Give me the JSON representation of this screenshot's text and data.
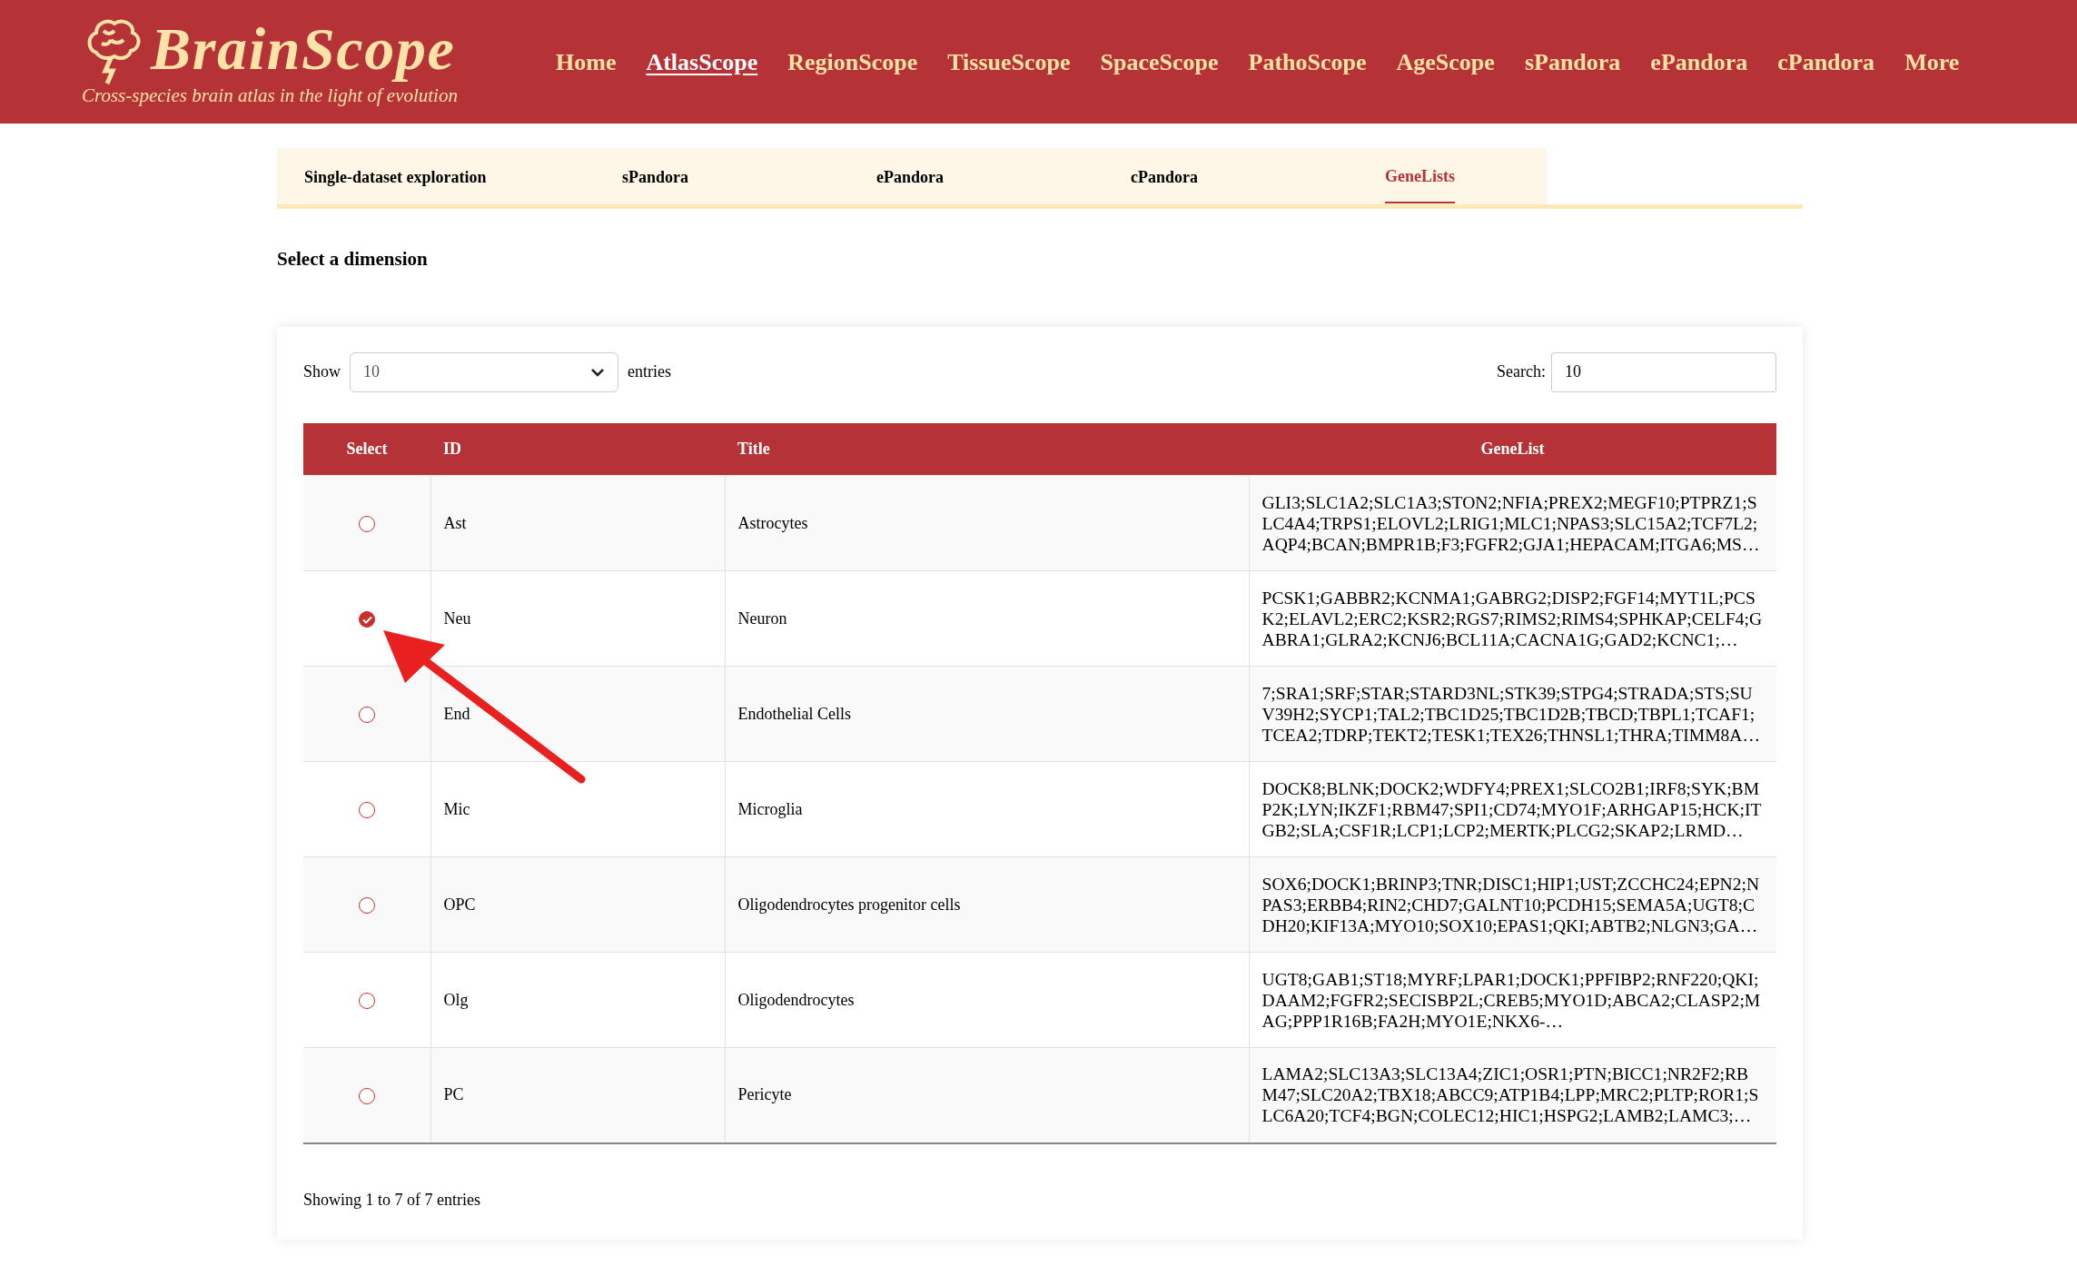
{
  "logo": {
    "title": "BrainScope",
    "tagline": "Cross-species brain atlas in the light of evolution"
  },
  "nav": [
    {
      "label": "Home",
      "selected": false
    },
    {
      "label": "AtlasScope",
      "selected": true
    },
    {
      "label": "RegionScope",
      "selected": false
    },
    {
      "label": "TissueScope",
      "selected": false
    },
    {
      "label": "SpaceScope",
      "selected": false
    },
    {
      "label": "PathoScope",
      "selected": false
    },
    {
      "label": "AgeScope",
      "selected": false
    },
    {
      "label": "sPandora",
      "selected": false
    },
    {
      "label": "ePandora",
      "selected": false
    },
    {
      "label": "cPandora",
      "selected": false
    },
    {
      "label": "More",
      "selected": false
    }
  ],
  "tabs": [
    {
      "label": "Single-dataset exploration",
      "selected": false
    },
    {
      "label": "sPandora",
      "selected": false
    },
    {
      "label": "ePandora",
      "selected": false
    },
    {
      "label": "cPandora",
      "selected": false
    },
    {
      "label": "GeneLists",
      "selected": true
    }
  ],
  "section_title": "Select a dimension",
  "table_controls": {
    "show_label": "Show",
    "page_size": "10",
    "entries_label": "entries",
    "search_label": "Search:",
    "search_value": "10"
  },
  "table": {
    "columns": [
      "Select",
      "ID",
      "Title",
      "GeneList"
    ],
    "rows": [
      {
        "selected": false,
        "id": "Ast",
        "title": "Astrocytes",
        "genelist": "GLI3;SLC1A2;SLC1A3;STON2;NFIA;PREX2;MEGF10;PTPRZ1;SLC4A4;TRPS1;ELOVL2;LRIG1;MLC1;NPAS3;SLC15A2;TCF7L2;AQP4;BCAN;BMPR1B;F3;FGFR2;GJA1;HEPACAM;ITGA6;MS…"
      },
      {
        "selected": true,
        "id": "Neu",
        "title": "Neuron",
        "genelist": "PCSK1;GABBR2;KCNMA1;GABRG2;DISP2;FGF14;MYT1L;PCSK2;ELAVL2;ERC2;KSR2;RGS7;RIMS2;RIMS4;SPHKAP;CELF4;GABRA1;GLRA2;KCNJ6;BCL11A;CACNA1G;GAD2;KCNC1;…"
      },
      {
        "selected": false,
        "id": "End",
        "title": "Endothelial Cells",
        "genelist": "7;SRA1;SRF;STAR;STARD3NL;STK39;STPG4;STRADA;STS;SUV39H2;SYCP1;TAL2;TBC1D25;TBC1D2B;TBCD;TBPL1;TCAF1;TCEA2;TDRP;TEKT2;TESK1;TEX26;THNSL1;THRA;TIMM8A…"
      },
      {
        "selected": false,
        "id": "Mic",
        "title": "Microglia",
        "genelist": "DOCK8;BLNK;DOCK2;WDFY4;PREX1;SLCO2B1;IRF8;SYK;BMP2K;LYN;IKZF1;RBM47;SPI1;CD74;MYO1F;ARHGAP15;HCK;ITGB2;SLA;CSF1R;LCP1;LCP2;MERTK;PLCG2;SKAP2;LRMD…"
      },
      {
        "selected": false,
        "id": "OPC",
        "title": "Oligodendrocytes progenitor cells",
        "genelist": "SOX6;DOCK1;BRINP3;TNR;DISC1;HIP1;UST;ZCCHC24;EPN2;NPAS3;ERBB4;RIN2;CHD7;GALNT10;PCDH15;SEMA5A;UGT8;CDH20;KIF13A;MYO10;SOX10;EPAS1;QKI;ABTB2;NLGN3;GA…"
      },
      {
        "selected": false,
        "id": "Olg",
        "title": "Oligodendrocytes",
        "genelist": "UGT8;GAB1;ST18;MYRF;LPAR1;DOCK1;PPFIBP2;RNF220;QKI;DAAM2;FGFR2;SECISBP2L;CREB5;MYO1D;ABCA2;CLASP2;MAG;PPP1R16B;FA2H;MYO1E;NKX6-…"
      },
      {
        "selected": false,
        "id": "PC",
        "title": "Pericyte",
        "genelist": "LAMA2;SLC13A3;SLC13A4;ZIC1;OSR1;PTN;BICC1;NR2F2;RBM47;SLC20A2;TBX18;ABCC9;ATP1B4;LPP;MRC2;PLTP;ROR1;SLC6A20;TCF4;BGN;COLEC12;HIC1;HSPG2;LAMB2;LAMC3;…"
      }
    ]
  },
  "table_info": "Showing 1 to 7 of 7 entries"
}
